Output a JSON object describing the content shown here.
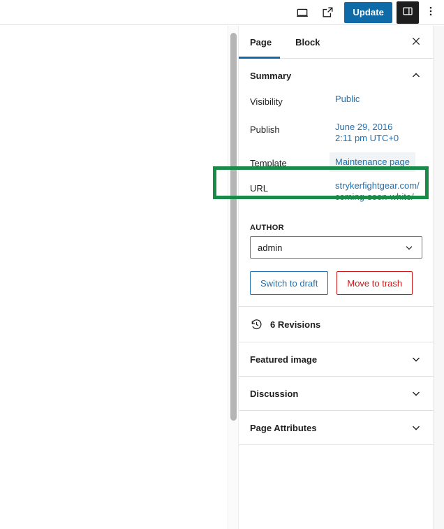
{
  "header": {
    "preview_icon": "desktop-preview-icon",
    "view_icon": "external-link-icon",
    "update_label": "Update",
    "settings_icon": "sidebar-toggle-icon",
    "more_icon": "kebab-menu-icon"
  },
  "sidebar": {
    "tabs": [
      {
        "label": "Page",
        "active": true
      },
      {
        "label": "Block",
        "active": false
      }
    ],
    "close_icon": "close-icon",
    "summary": {
      "title": "Summary",
      "collapse_icon": "chevron-up-icon",
      "rows": [
        {
          "label": "Visibility",
          "value": "Public",
          "type": "link"
        },
        {
          "label": "Publish",
          "value": "June 29, 2016\n2:11 pm UTC+0",
          "type": "link"
        },
        {
          "label": "Template",
          "value": "Maintenance page",
          "type": "pill"
        },
        {
          "label": "URL",
          "value": "strykerfightgear.com/coming-soon-white/",
          "type": "url"
        }
      ],
      "author": {
        "label": "AUTHOR",
        "value": "admin",
        "chevron_icon": "chevron-down-icon"
      },
      "actions": {
        "switch_to_draft": "Switch to draft",
        "move_to_trash": "Move to trash"
      }
    },
    "revisions": {
      "icon": "backup-clock-icon",
      "label": "6 Revisions"
    },
    "panels": [
      {
        "label": "Featured image",
        "chevron_icon": "chevron-down-icon"
      },
      {
        "label": "Discussion",
        "chevron_icon": "chevron-down-icon"
      },
      {
        "label": "Page Attributes",
        "chevron_icon": "chevron-down-icon"
      }
    ]
  },
  "annotation": {
    "target": "template-row",
    "color": "#1a8a48"
  },
  "colors": {
    "accent_blue": "#0e6ba8",
    "link_blue": "#2271b1",
    "danger_red": "#cc1818",
    "highlight_green": "#1a8a48"
  }
}
